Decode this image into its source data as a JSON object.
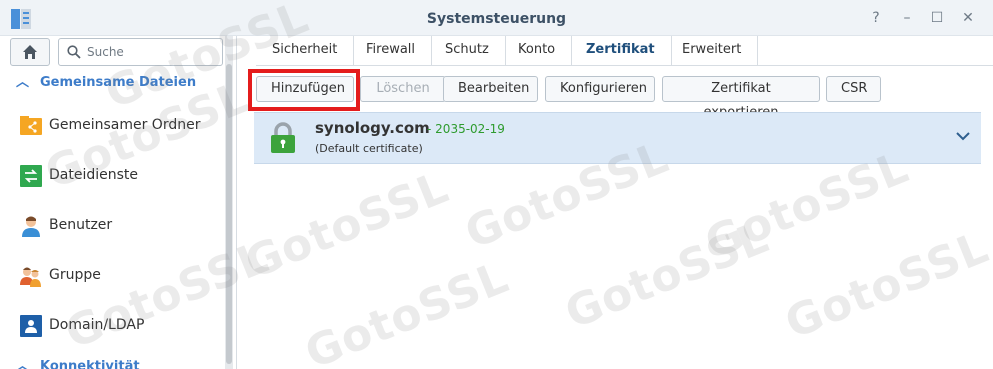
{
  "window": {
    "title": "Systemsteuerung",
    "controls": [
      "?",
      "–",
      "☐",
      "✕"
    ]
  },
  "sidebar": {
    "search_placeholder": "Suche",
    "sections": [
      {
        "label": "Gemeinsame Dateien",
        "items": [
          {
            "label": "Gemeinsamer Ordner",
            "icon": "shared-folder-icon"
          },
          {
            "label": "Dateidienste",
            "icon": "file-services-icon"
          },
          {
            "label": "Benutzer",
            "icon": "user-icon"
          },
          {
            "label": "Gruppe",
            "icon": "group-icon"
          },
          {
            "label": "Domain/LDAP",
            "icon": "domain-ldap-icon"
          }
        ]
      },
      {
        "label": "Konnektivität"
      }
    ]
  },
  "tabs": [
    {
      "label": "Sicherheit"
    },
    {
      "label": "Firewall"
    },
    {
      "label": "Schutz"
    },
    {
      "label": "Konto"
    },
    {
      "label": "Zertifikat",
      "active": true
    },
    {
      "label": "Erweitert"
    }
  ],
  "toolbar": {
    "add": "Hinzufügen",
    "delete": "Löschen",
    "edit": "Bearbeiten",
    "configure": "Konfigurieren",
    "export": "Zertifikat exportieren",
    "csr": "CSR"
  },
  "certificate": {
    "name": "synology.com",
    "separator": "-",
    "expiry": "2035-02-19",
    "note": "(Default certificate)"
  },
  "watermark": "GotoSSL",
  "colors": {
    "accent": "#3d7cc9",
    "highlight": "#e41c1c",
    "cert_row": "#dce9f7",
    "lock_green": "#3ca33c"
  }
}
